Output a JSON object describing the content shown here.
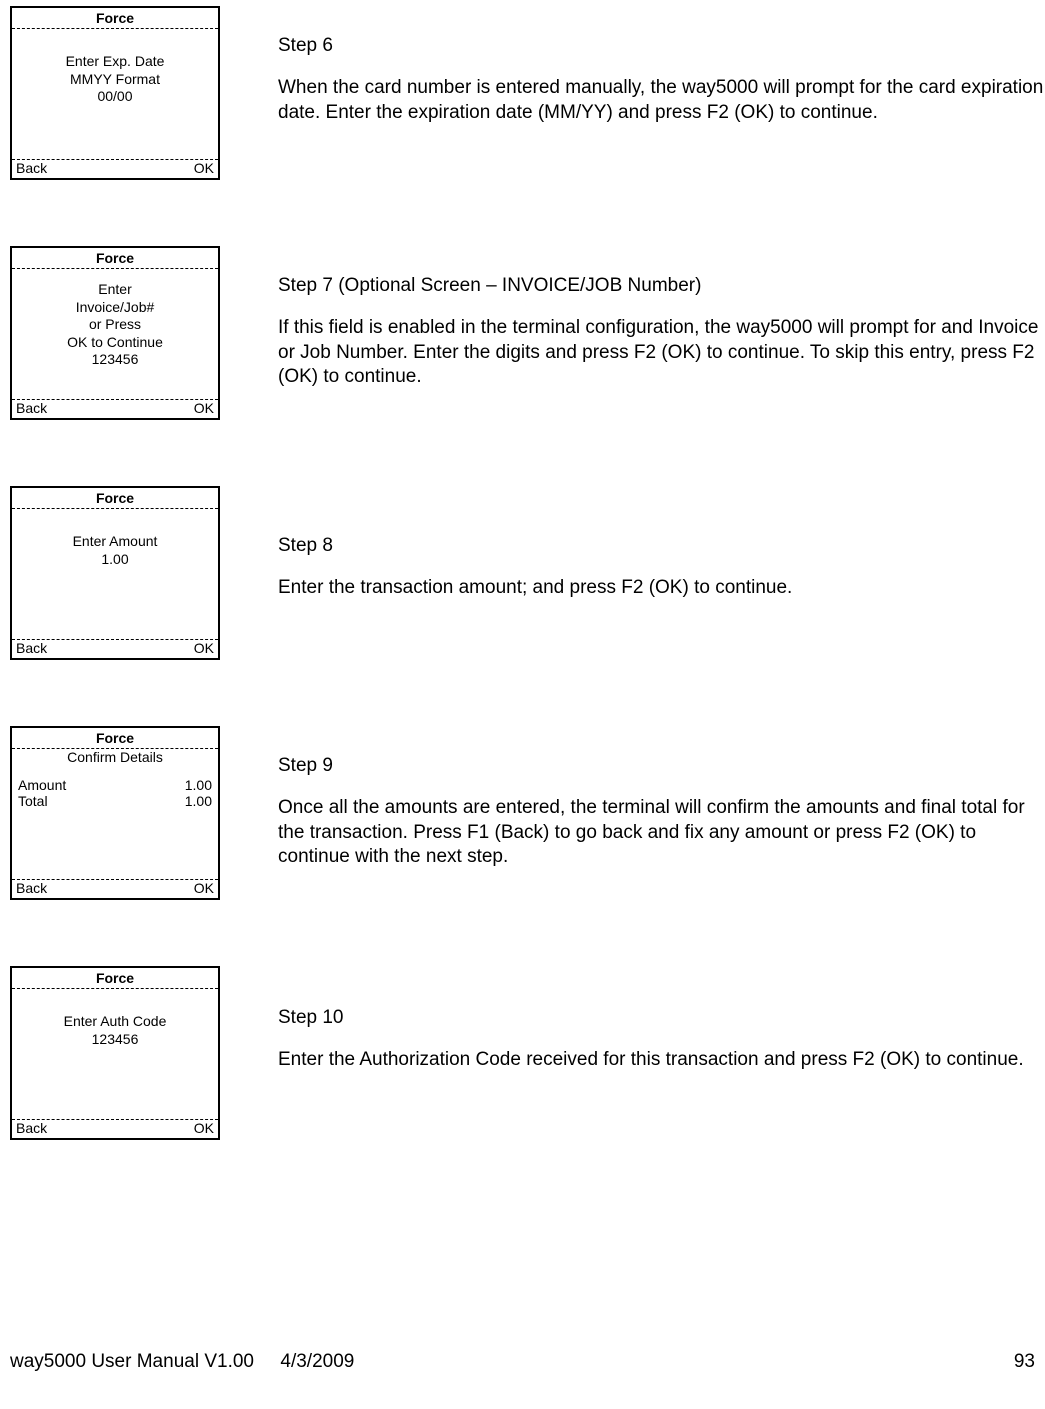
{
  "screens": [
    {
      "title": "Force",
      "lines": [
        "Enter Exp. Date",
        "MMYY Format",
        "00/00"
      ],
      "back": "Back",
      "ok": "OK",
      "step": "Step 6",
      "body": "When the card number is entered manually, the way5000 will prompt for the card expiration date. Enter the expiration date (MM/YY) and press F2 (OK) to continue."
    },
    {
      "title": "Force",
      "lines": [
        "Enter",
        "Invoice/Job#",
        "or Press",
        "OK to Continue",
        "123456"
      ],
      "back": "Back",
      "ok": "OK",
      "step": "Step 7 (Optional Screen – INVOICE/JOB Number)",
      "body": "If this field is enabled in the terminal configuration, the way5000 will prompt for and Invoice or Job Number. Enter the digits and press F2 (OK) to continue.   To skip this entry, press F2 (OK) to continue."
    },
    {
      "title": "Force",
      "lines": [
        "Enter Amount",
        "1.00"
      ],
      "back": "Back",
      "ok": "OK",
      "step": "Step 8",
      "body": "Enter the transaction amount; and press F2 (OK) to continue."
    },
    {
      "title": "Force",
      "subhead": "Confirm Details",
      "kv": [
        {
          "k": "Amount",
          "v": "1.00"
        },
        {
          "k": "Total",
          "v": "1.00"
        }
      ],
      "back": "Back",
      "ok": "OK",
      "step": "Step 9",
      "body": "Once all the amounts are entered, the terminal will confirm the amounts and final total for the transaction. Press F1 (Back) to go back and fix any amount or press F2 (OK) to continue with the next step."
    },
    {
      "title": "Force",
      "lines": [
        "Enter Auth Code",
        "123456"
      ],
      "back": "Back",
      "ok": "OK",
      "step": "Step 10",
      "body": "Enter the Authorization Code received for this transaction and press F2 (OK) to continue."
    }
  ],
  "footer": {
    "doc": "way5000 User Manual V1.00",
    "date": "4/3/2009",
    "page": "93"
  }
}
